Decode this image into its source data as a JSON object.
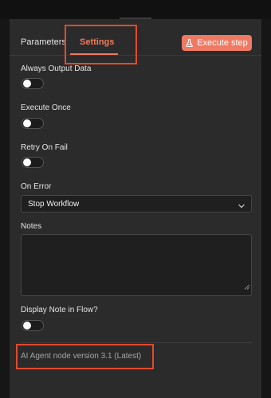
{
  "tabs": [
    {
      "label": "Parameters"
    },
    {
      "label": "Settings",
      "active": true
    }
  ],
  "execute_button": {
    "label": "Execute step",
    "icon": "flask-icon",
    "color": "#ef7a63"
  },
  "settings": {
    "always_output_data": {
      "label": "Always Output Data",
      "enabled": false
    },
    "execute_once": {
      "label": "Execute Once",
      "enabled": false
    },
    "retry_on_fail": {
      "label": "Retry On Fail",
      "enabled": false
    },
    "on_error": {
      "label": "On Error",
      "value": "Stop Workflow"
    },
    "notes": {
      "label": "Notes",
      "value": ""
    },
    "display_note": {
      "label": "Display Note in Flow?",
      "enabled": false
    }
  },
  "footer": {
    "version_text": "AI Agent node version 3.1 (Latest)"
  },
  "colors": {
    "accent": "#f07a5a",
    "highlight_box": "#e24a2c",
    "background": "#2b2b2b"
  }
}
